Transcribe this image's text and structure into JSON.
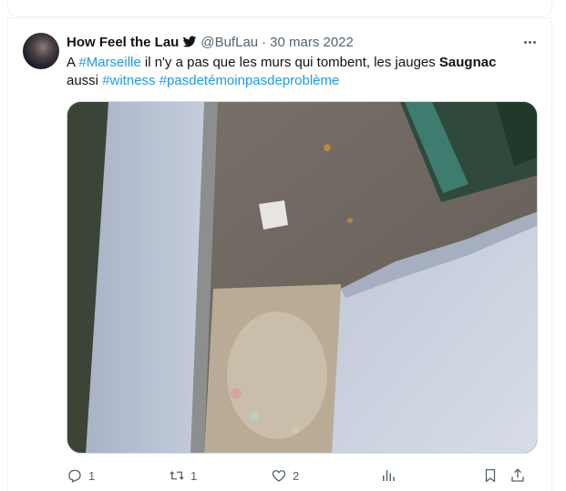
{
  "tweet": {
    "display_name": "How Feel the Lau",
    "handle": "@BufLau",
    "separator": "·",
    "date": "30 mars 2022",
    "text": {
      "part1": "A ",
      "tag1": "#Marseille",
      "part2": " il n'y a pas que les murs qui tombent, les jauges ",
      "bold": "Saugnac",
      "part3": " aussi ",
      "tag2": "#witness",
      "space": " ",
      "tag3": "#pasdetémoinpasdeproblème"
    },
    "media_icon": "photo-of-damaged-wall"
  },
  "actions": {
    "reply_count": "1",
    "retweet_count": "1",
    "like_count": "2"
  },
  "icons": {
    "verified": "twitter-bird-icon",
    "more": "more-icon",
    "reply": "reply-icon",
    "retweet": "retweet-icon",
    "like": "heart-icon",
    "views": "views-icon",
    "bookmark": "bookmark-icon",
    "share": "share-icon"
  },
  "colors": {
    "link": "#1d9bf0",
    "secondary_text": "#536471",
    "primary_text": "#0f1419"
  }
}
